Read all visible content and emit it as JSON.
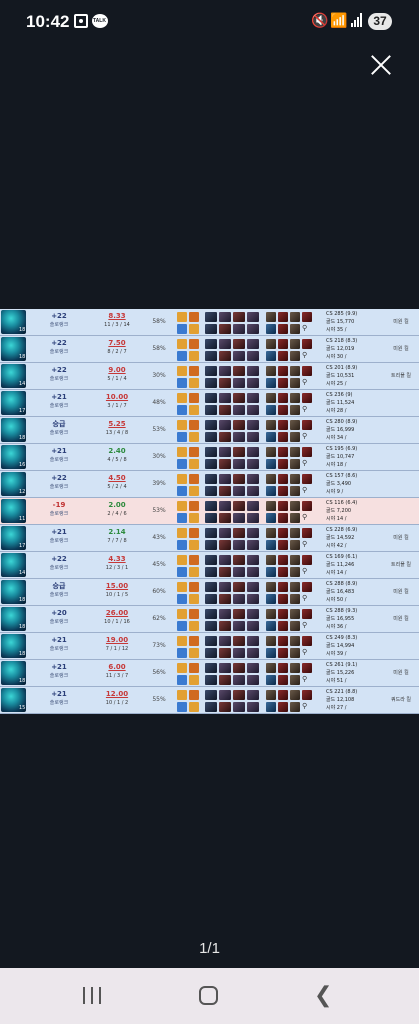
{
  "status_bar": {
    "time": "10:42",
    "battery": "37"
  },
  "viewer": {
    "page_indicator": "1/1",
    "watermark": ""
  },
  "colors": {
    "spell_flash": "#e2a032",
    "spell_tp": "#3a7ad0",
    "spell_ignite": "#d06a20",
    "row_win": "#d3e3f5",
    "row_lose": "#f6e0e0"
  },
  "matches": [
    {
      "champ_level": "18",
      "lp": "+22",
      "tier": "솔로랭크",
      "kda_ratio": "8.33",
      "score": "11 / 3 / 14",
      "kp": "58%",
      "cs": "CS 285 (9.9)",
      "gold": "골드 15,770",
      "vision": "시야 35 / ",
      "tag": "미원 킬",
      "result": "win"
    },
    {
      "champ_level": "18",
      "lp": "+22",
      "tier": "솔로랭크",
      "kda_ratio": "7.50",
      "score": "8 / 2 / 7",
      "kp": "58%",
      "cs": "CS 218 (8.3)",
      "gold": "골드 12,019",
      "vision": "시야 30 / ",
      "tag": "미원 킬",
      "result": "win"
    },
    {
      "champ_level": "14",
      "lp": "+22",
      "tier": "솔로랭크",
      "kda_ratio": "9.00",
      "score": "5 / 1 / 4",
      "kp": "30%",
      "cs": "CS 201 (8.9)",
      "gold": "골드 10,531",
      "vision": "시야 25 / ",
      "tag": "트리플 킬",
      "result": "win"
    },
    {
      "champ_level": "17",
      "lp": "+21",
      "tier": "솔로랭크",
      "kda_ratio": "10.00",
      "score": "3 / 1 / 7",
      "kp": "48%",
      "cs": "CS 236 (9)",
      "gold": "골드 11,524",
      "vision": "시야 28 / ",
      "tag": "",
      "result": "win"
    },
    {
      "champ_level": "18",
      "lp": "승급",
      "tier": "솔로랭크",
      "kda_ratio": "5.25",
      "score": "13 / 4 / 8",
      "kp": "53%",
      "cs": "CS 280 (8.9)",
      "gold": "골드 16,999",
      "vision": "시야 34 / ",
      "tag": "",
      "result": "win"
    },
    {
      "champ_level": "16",
      "lp": "+21",
      "tier": "솔로랭크",
      "kda_ratio": "2.40",
      "score": "4 / 5 / 8",
      "kp": "30%",
      "cs": "CS 195 (6.9)",
      "gold": "골드 10,747",
      "vision": "시야 18 / ",
      "tag": "",
      "result": "win"
    },
    {
      "champ_level": "12",
      "lp": "+22",
      "tier": "솔로랭크",
      "kda_ratio": "4.50",
      "score": "5 / 2 / 4",
      "kp": "39%",
      "cs": "CS 157 (8.6)",
      "gold": "골드 3,490",
      "vision": "시야 9 / ",
      "tag": "",
      "result": "win"
    },
    {
      "champ_level": "11",
      "lp": "-19",
      "tier": "솔로랭크",
      "kda_ratio": "2.00",
      "score": "2 / 4 / 6",
      "kp": "53%",
      "cs": "CS 116 (6.4)",
      "gold": "골드 7,200",
      "vision": "시야 14 / ",
      "tag": "",
      "result": "lose"
    },
    {
      "champ_level": "17",
      "lp": "+21",
      "tier": "솔로랭크",
      "kda_ratio": "2.14",
      "score": "7 / 7 / 8",
      "kp": "43%",
      "cs": "CS 228 (6.9)",
      "gold": "골드 14,592",
      "vision": "시야 42 / ",
      "tag": "미원 킬",
      "result": "win"
    },
    {
      "champ_level": "14",
      "lp": "+22",
      "tier": "솔로랭크",
      "kda_ratio": "4.33",
      "score": "12 / 3 / 1",
      "kp": "45%",
      "cs": "CS 169 (6.1)",
      "gold": "골드 11,246",
      "vision": "시야 14 / ",
      "tag": "트리플 킬",
      "result": "win"
    },
    {
      "champ_level": "18",
      "lp": "승급",
      "tier": "솔로랭크",
      "kda_ratio": "15.00",
      "score": "10 / 1 / 5",
      "kp": "60%",
      "cs": "CS 288 (8.9)",
      "gold": "골드 16,483",
      "vision": "시야 50 / ",
      "tag": "미원 킬",
      "result": "win"
    },
    {
      "champ_level": "18",
      "lp": "+20",
      "tier": "솔로랭크",
      "kda_ratio": "26.00",
      "score": "10 / 1 / 16",
      "kp": "62%",
      "cs": "CS 288 (9.3)",
      "gold": "골드 16,955",
      "vision": "시야 36 / ",
      "tag": "미원 킬",
      "result": "win"
    },
    {
      "champ_level": "18",
      "lp": "+21",
      "tier": "솔로랭크",
      "kda_ratio": "19.00",
      "score": "7 / 1 / 12",
      "kp": "73%",
      "cs": "CS 249 (8.3)",
      "gold": "골드 14,994",
      "vision": "시야 39 / ",
      "tag": "",
      "result": "win"
    },
    {
      "champ_level": "18",
      "lp": "+21",
      "tier": "솔로랭크",
      "kda_ratio": "6.00",
      "score": "11 / 3 / 7",
      "kp": "56%",
      "cs": "CS 261 (9.1)",
      "gold": "골드 15,226",
      "vision": "시야 51 / ",
      "tag": "미원 킬",
      "result": "win"
    },
    {
      "champ_level": "15",
      "lp": "+21",
      "tier": "솔로랭크",
      "kda_ratio": "12.00",
      "score": "10 / 1 / 2",
      "kp": "55%",
      "cs": "CS 221 (8.8)",
      "gold": "골드 12,108",
      "vision": "시야 27 / ",
      "tag": "쿼드라 킬",
      "result": "win"
    }
  ]
}
